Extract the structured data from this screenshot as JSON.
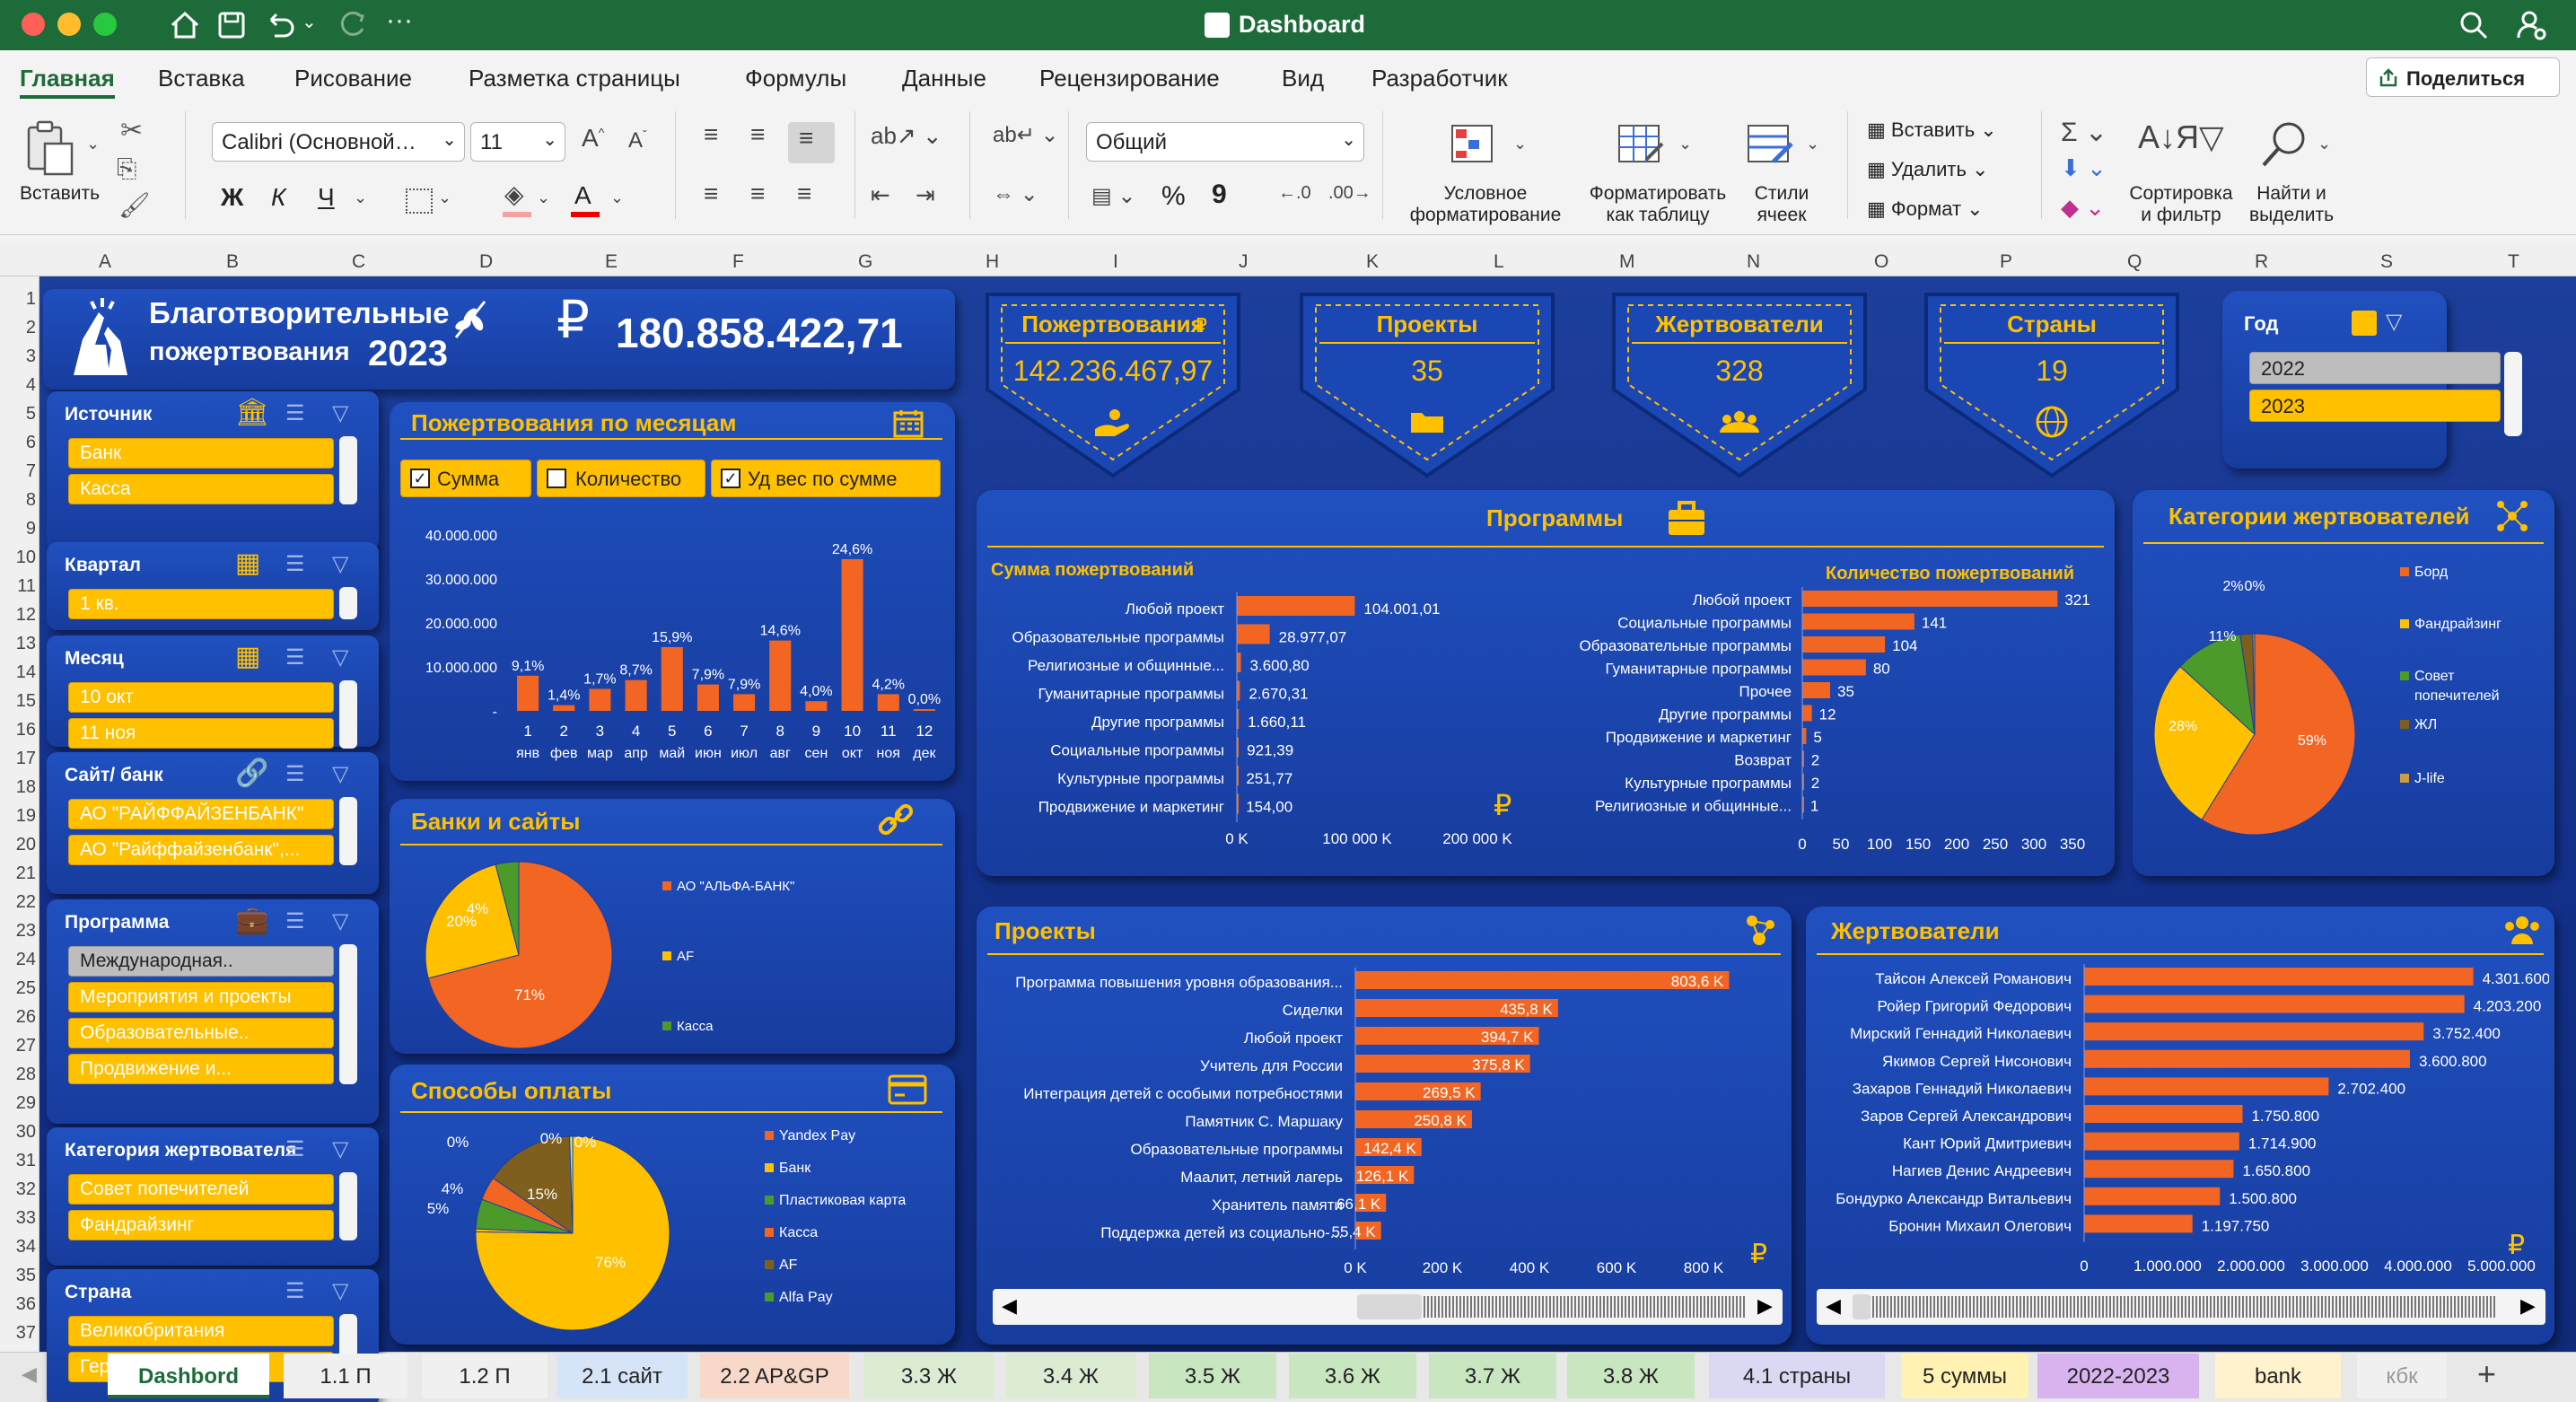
{
  "window": {
    "title": "Dashboard",
    "share_label": "Поделиться"
  },
  "menu": [
    "Главная",
    "Вставка",
    "Рисование",
    "Разметка страницы",
    "Формулы",
    "Данные",
    "Рецензирование",
    "Вид",
    "Разработчик"
  ],
  "ribbon": {
    "paste": "Вставить",
    "font_name": "Calibri (Основной…",
    "font_size": "11",
    "number_format": "Общий",
    "cond_format": [
      "Условное",
      "форматирование"
    ],
    "format_table": [
      "Форматировать",
      "как таблицу"
    ],
    "cell_styles": [
      "Стили",
      "ячеек"
    ],
    "insert": "Вставить",
    "delete": "Удалить",
    "format": "Формат",
    "sort_filter": [
      "Сортировка",
      "и фильтр"
    ],
    "find_select": [
      "Найти и",
      "выделить"
    ],
    "bold": "Ж",
    "italic": "К",
    "underline": "Ч",
    "percent": "%",
    "comma": "9"
  },
  "columns": [
    "A",
    "B",
    "C",
    "D",
    "E",
    "F",
    "G",
    "H",
    "I",
    "J",
    "K",
    "L",
    "M",
    "N",
    "O",
    "P",
    "Q",
    "R",
    "S",
    "T"
  ],
  "rows": [
    "1",
    "2",
    "3",
    "4",
    "5",
    "6",
    "7",
    "8",
    "9",
    "10",
    "11",
    "12",
    "13",
    "14",
    "15",
    "16",
    "17",
    "18",
    "19",
    "20",
    "21",
    "22",
    "23",
    "24",
    "25",
    "26",
    "27",
    "28",
    "29",
    "30",
    "31",
    "32",
    "33",
    "34",
    "35",
    "36",
    "37"
  ],
  "header": {
    "title1": "Благотворительные",
    "title2": "пожертвования",
    "year": "2023",
    "currency": "₽",
    "total": "180.858.422,71"
  },
  "kpis": [
    {
      "label": "Пожертвования",
      "value": "142.236.467,97",
      "icon": "hand-coin-icon"
    },
    {
      "label": "Проекты",
      "value": "35",
      "icon": "folder-icon"
    },
    {
      "label": "Жертвователи",
      "value": "328",
      "icon": "people-icon"
    },
    {
      "label": "Страны",
      "value": "19",
      "icon": "globe-icon"
    }
  ],
  "year_slicer": {
    "title": "Год",
    "items": [
      "2022",
      "2023"
    ]
  },
  "slicers": [
    {
      "title": "Источник",
      "items": [
        "Банк",
        "Касса"
      ]
    },
    {
      "title": "Квартал",
      "items": [
        "1 кв."
      ]
    },
    {
      "title": "Месяц",
      "items": [
        "10 окт",
        "11 ноя"
      ]
    },
    {
      "title": "Сайт/ банк",
      "items": [
        "АО \"РАЙФФАЙЗЕНБАНК\"",
        "АО \"Райффайзенбанк\",..."
      ]
    },
    {
      "title": "Программа",
      "items": [
        "Международная..",
        "Мероприятия и проекты",
        "Образовательные..",
        "Продвижение и..."
      ]
    },
    {
      "title": "Категория жертвователя",
      "items": [
        "Совет попечителей",
        "Фандрайзинг"
      ]
    },
    {
      "title": "Страна",
      "items": [
        "Великобритания",
        "Германия"
      ]
    }
  ],
  "monthly": {
    "title": "Пожертвования по месяцам",
    "checks": [
      "Сумма",
      "Количество",
      "Уд вес по сумме"
    ]
  },
  "banks_title": "Банки и сайты",
  "pay_title": "Способы оплаты",
  "programs_title": "Программы",
  "programs_sum_title": "Сумма пожертвований",
  "programs_cnt_title": "Количество пожертвований",
  "donor_cat_title": "Категории жертвователей",
  "projects_title": "Проекты",
  "donors_title": "Жертвователи",
  "chart_data": [
    {
      "id": "monthly",
      "type": "bar",
      "categories": [
        "1 янв",
        "2 фев",
        "3 мар",
        "4 апр",
        "5 май",
        "6 июн",
        "7 июл",
        "8 авг",
        "9 сен",
        "10 окт",
        "11 ноя",
        "12 дек"
      ],
      "x_top": [
        "1",
        "2",
        "3",
        "4",
        "5",
        "6",
        "7",
        "8",
        "9",
        "10",
        "11",
        "12"
      ],
      "x_bottom": [
        "янв",
        "фев",
        "мар",
        "апр",
        "май",
        "июн",
        "июл",
        "авг",
        "сен",
        "окт",
        "ноя",
        "дек"
      ],
      "values": [
        8000000,
        1300000,
        5000000,
        7000000,
        14500000,
        6000000,
        3800000,
        16000000,
        2200000,
        34500000,
        3800000,
        400000
      ],
      "data_labels": [
        "9,1%",
        "1,4%",
        "1,7%",
        "8,7%",
        "15,9%",
        "7,9%",
        "7,9%",
        "14,6%",
        "4,0%",
        "24,6%",
        "4,2%",
        "0,0%"
      ],
      "ylim": [
        0,
        40000000
      ],
      "yticks": [
        "40.000.000",
        "30.000.000",
        "20.000.000",
        "10.000.000",
        "-"
      ]
    },
    {
      "id": "banks",
      "type": "pie",
      "labels": [
        "АО \"АЛЬФА-БАНК\"",
        "AF",
        "Касса"
      ],
      "values": [
        71,
        20,
        4
      ],
      "data_labels": [
        "71%",
        "20%",
        "4%"
      ]
    },
    {
      "id": "payments",
      "type": "pie",
      "labels": [
        "Yandex Pay",
        "Банк",
        "Пластиковая карта",
        "Касса",
        "AF",
        "Alfa Pay"
      ],
      "values": [
        76,
        0,
        5,
        4,
        15,
        0
      ],
      "data_labels": [
        "76%",
        "0%",
        "5%",
        "4%",
        "15%",
        "0%",
        "0%"
      ]
    },
    {
      "id": "programs_sum",
      "type": "bar",
      "categories": [
        "Любой проект",
        "Образовательные программы",
        "Религиозные и общинные...",
        "Гуманитарные программы",
        "Другие программы",
        "Социальные программы",
        "Культурные программы",
        "Продвижение и маркетинг"
      ],
      "values": [
        104001.01,
        28977.07,
        3600.8,
        2670.31,
        1660.11,
        921.39,
        251.77,
        154.0
      ],
      "data_labels": [
        "104.001,01",
        "28.977,07",
        "3.600,80",
        "2.670,31",
        "1.660,11",
        "921,39",
        "251,77",
        "154,00"
      ],
      "xticks": [
        "0 K",
        "100 000 K",
        "200 000 K"
      ],
      "xlim": [
        0,
        220000
      ]
    },
    {
      "id": "programs_count",
      "type": "bar",
      "categories": [
        "Любой проект",
        "Социальные программы",
        "Образовательные программы",
        "Гуманитарные программы",
        "Прочее",
        "Другие программы",
        "Продвижение и маркетинг",
        "Возврат",
        "Культурные программы",
        "Религиозные и общинные..."
      ],
      "values": [
        321,
        141,
        104,
        80,
        35,
        12,
        5,
        2,
        2,
        1
      ],
      "xticks": [
        "0",
        "50",
        "100",
        "150",
        "200",
        "250",
        "300",
        "350"
      ],
      "xlim": [
        0,
        350
      ]
    },
    {
      "id": "donor_categories",
      "type": "pie",
      "labels": [
        "Борд",
        "Фандрайзинг",
        "Совет попечителей",
        "ЖЛ",
        "J-life"
      ],
      "values": [
        59,
        28,
        11,
        2,
        0
      ],
      "data_labels": [
        "59%",
        "28%",
        "11%",
        "2%",
        "0%"
      ]
    },
    {
      "id": "projects",
      "type": "bar",
      "categories": [
        "Программа повышения уровня образования...",
        "Сиделки",
        "Любой проект",
        "Учитель для России",
        "Интеграция детей с особыми потребностями",
        "Памятник С. Маршаку",
        "Образовательные программы",
        "Маалит, летний лагерь",
        "Хранитель памяти",
        "Поддержка детей из социально-..."
      ],
      "values": [
        803.6,
        435.8,
        394.7,
        375.8,
        269.5,
        250.8,
        142.4,
        126.1,
        66.1,
        55.4
      ],
      "data_labels": [
        "803,6 K",
        "435,8 K",
        "394,7 K",
        "375,8 K",
        "269,5 K",
        "250,8 K",
        "142,4 K",
        "126,1 K",
        "66,1 K",
        "55,4 K"
      ],
      "xticks": [
        "0 K",
        "200 K",
        "400 K",
        "600 K",
        "800 K"
      ],
      "xlim": [
        0,
        880
      ]
    },
    {
      "id": "donors",
      "type": "bar",
      "categories": [
        "Тайсон Алексей Романович",
        "Ройер Григорий Федорович",
        "Мирский Геннадий Николаевич",
        "Якимов Сергей Нисонович",
        "Захаров Геннадий Николаевич",
        "Заров Сергей Александрович",
        "Кант Юрий Дмитриевич",
        "Нагиев Денис Андреевич",
        "Бондурко Александр Витальевич",
        "Бронин Михаил Олегович"
      ],
      "values": [
        4301600,
        4203200,
        3752400,
        3600800,
        2702400,
        1750800,
        1714900,
        1650800,
        1500800,
        1197750
      ],
      "data_labels": [
        "4.301.600",
        "4.203.200",
        "3.752.400",
        "3.600.800",
        "2.702.400",
        "1.750.800",
        "1.714.900",
        "1.650.800",
        "1.500.800",
        "1.197.750"
      ],
      "xticks": [
        "0",
        "1.000.000",
        "2.000.000",
        "3.000.000",
        "4.000.000",
        "5.000.000"
      ],
      "xlim": [
        0,
        5000000
      ]
    }
  ],
  "sheet_tabs": [
    {
      "label": "Dashbord",
      "color": "#ffffff"
    },
    {
      "label": "1.1 П",
      "color": "#f0f0f0"
    },
    {
      "label": "1.2 П",
      "color": "#f0f0f0"
    },
    {
      "label": "2.1 сайт",
      "color": "#d6e4f7"
    },
    {
      "label": "2.2 AP&GP",
      "color": "#f8d9c9"
    },
    {
      "label": "3.3 Ж",
      "color": "#dcecd3"
    },
    {
      "label": "3.4 Ж",
      "color": "#dcecd3"
    },
    {
      "label": "3.5 Ж",
      "color": "#c8e6c0"
    },
    {
      "label": "3.6 Ж",
      "color": "#c8e6c0"
    },
    {
      "label": "3.7 Ж",
      "color": "#c8e6c0"
    },
    {
      "label": "3.8 Ж",
      "color": "#c8e6c0"
    },
    {
      "label": "4.1 страны",
      "color": "#dad8f2"
    },
    {
      "label": "5 суммы",
      "color": "#fff2b3"
    },
    {
      "label": "2022-2023",
      "color": "#d9b3f0"
    },
    {
      "label": "bank",
      "color": "#fff2cc"
    },
    {
      "label": "кбк",
      "color": "#f0f0f0"
    }
  ],
  "colors": {
    "title_bar": "#1e6b3a",
    "dash_bg": "#173c9e",
    "accent": "#ffc000",
    "bar": "#f26522",
    "pie_orange": "#f26522",
    "pie_yellow": "#ffc000",
    "pie_green": "#4c9a2a",
    "pie_brown": "#7f5f1e"
  }
}
